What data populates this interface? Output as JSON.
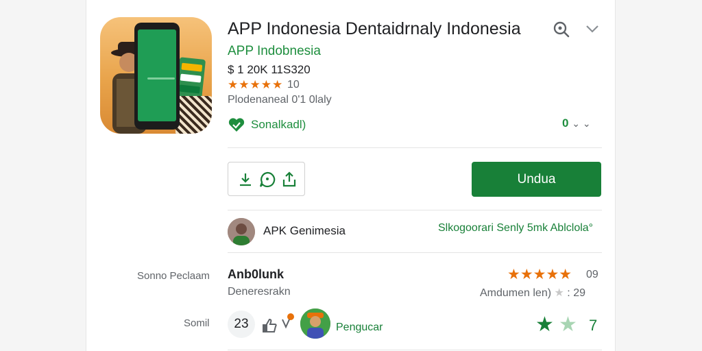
{
  "app": {
    "title": "APP Indonesia Dentaidrnaly Indonesia",
    "developer": "APP Indobnesia",
    "price": "$ 1 20K 11S320",
    "stars": "★★★★★",
    "rating": "10",
    "downloads": "Plodenaneal 0'1 0laly",
    "verified_label": "Sonalkadl)",
    "count_badge": "0",
    "count_badge_suffix": "⌄ ⌄"
  },
  "actions": {
    "install_label": "Undua"
  },
  "developer_row": {
    "name": "APK Genimesia",
    "link": "Slkogoorari Senly 5mk Ablclola°"
  },
  "review_row": {
    "label": "Sonno Peclaam",
    "title": "Anb0lunk",
    "subtitle": "Deneresrakn",
    "stars": "★★★★★",
    "count": "09",
    "meta_text": "Amdumen len)",
    "meta_stars": "★",
    "meta_sep": ":",
    "meta_count": "29"
  },
  "bottom_row": {
    "label": "Somil",
    "number": "23",
    "user_name": "Pengucar",
    "star_a": "★",
    "star_b": "★",
    "count": "7"
  },
  "colors": {
    "accent_green": "#188038",
    "link_green": "#1e8e3e",
    "star_orange": "#e8710a",
    "muted": "#5f6368"
  },
  "icons": {
    "search": "search-icon",
    "chevron": "chevron-down-icon",
    "verified": "heart-check-icon",
    "download": "download-icon",
    "chat": "chat-icon",
    "share": "share-icon",
    "thumb": "thumb-up-icon",
    "flag": "flag-icon"
  }
}
